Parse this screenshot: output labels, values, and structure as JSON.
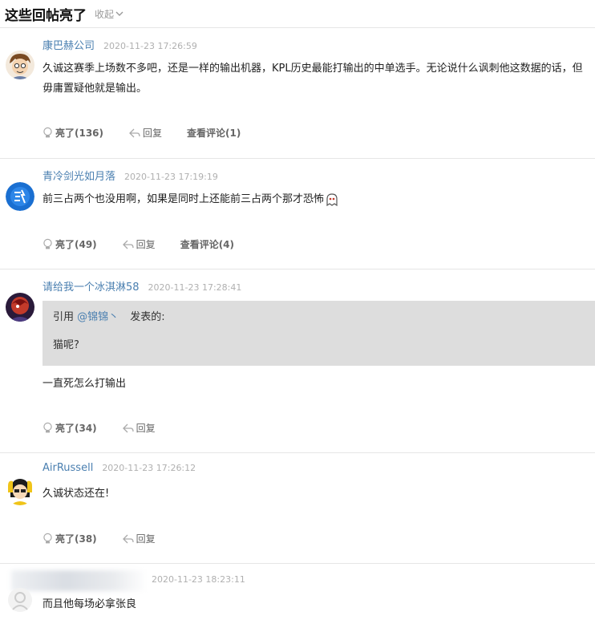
{
  "header": {
    "title": "这些回帖亮了",
    "collapse_label": "收起"
  },
  "posts": [
    {
      "username": "康巴赫公司",
      "time": "2020-11-23 17:26:59",
      "text": "久诚这赛季上场数不多吧，还是一样的输出机器，KPL历史最能打输出的中单选手。无论说什么讽刺他这数据的话，但毋庸置疑他就是输出。",
      "like_label": "亮了(136)",
      "reply_label": "回复",
      "comments_label": "查看评论(1)"
    },
    {
      "username": "青冷剑光如月落",
      "time": "2020-11-23 17:19:19",
      "text": "前三占两个也没用啊，如果是同时上还能前三占两个那才恐怖",
      "like_label": "亮了(49)",
      "reply_label": "回复",
      "comments_label": "查看评论(4)"
    },
    {
      "username": "请给我一个冰淇淋58",
      "time": "2020-11-23 17:28:41",
      "quote": {
        "prefix": "引用 ",
        "quoted_user": "@锦锦丶",
        "suffix": "发表的:",
        "text": "猫呢?"
      },
      "text": "一直死怎么打输出",
      "like_label": "亮了(34)",
      "reply_label": "回复"
    },
    {
      "username": "AirRussell",
      "time": "2020-11-23 17:26:12",
      "text": "久诚状态还在!",
      "like_label": "亮了(38)",
      "reply_label": "回复"
    },
    {
      "username": "",
      "time": "2020-11-23 18:23:11",
      "text": "而且他每场必拿张良"
    }
  ],
  "colors": {
    "username": "#4a7fb0",
    "time": "#b0b0b0",
    "quote_bg": "#dddddd",
    "divider": "#e6e6e6"
  }
}
